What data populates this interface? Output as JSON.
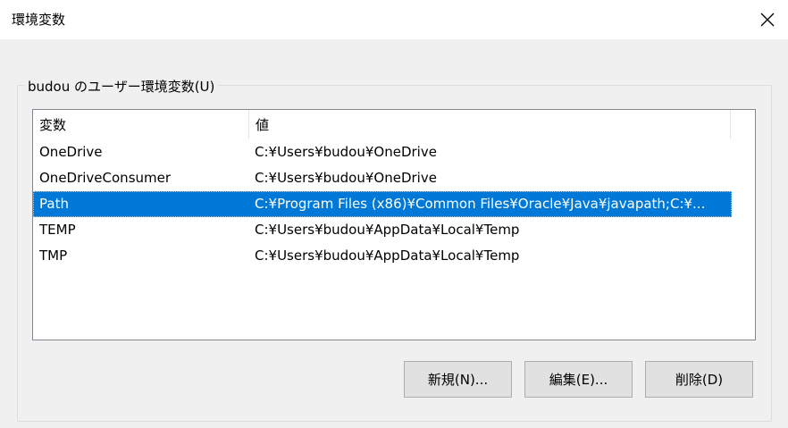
{
  "window": {
    "title": "環境変数"
  },
  "user_group": {
    "label": "budou のユーザー環境変数(U)"
  },
  "table": {
    "columns": [
      "変数",
      "値"
    ],
    "rows": [
      {
        "name": "OneDrive",
        "value": "C:¥Users¥budou¥OneDrive",
        "selected": false
      },
      {
        "name": "OneDriveConsumer",
        "value": "C:¥Users¥budou¥OneDrive",
        "selected": false
      },
      {
        "name": "Path",
        "value": "C:¥Program Files (x86)¥Common Files¥Oracle¥Java¥javapath;C:¥...",
        "selected": true
      },
      {
        "name": "TEMP",
        "value": "C:¥Users¥budou¥AppData¥Local¥Temp",
        "selected": false
      },
      {
        "name": "TMP",
        "value": "C:¥Users¥budou¥AppData¥Local¥Temp",
        "selected": false
      }
    ]
  },
  "buttons": {
    "new": "新規(N)...",
    "edit": "編集(E)...",
    "delete": "削除(D)"
  },
  "icons": {
    "close": "close-icon"
  },
  "colors": {
    "selection": "#0078d7",
    "window_bg": "#f0f0f0",
    "titlebar_bg": "#ffffff"
  }
}
